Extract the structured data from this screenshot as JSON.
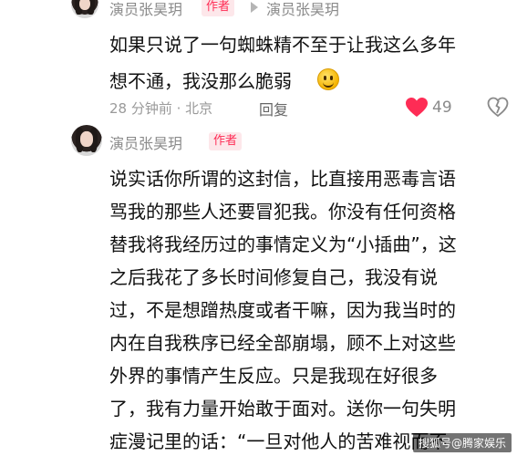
{
  "comment1": {
    "author": "演员张昊玥",
    "badge": "作者",
    "reply_to": "演员张昊玥",
    "lines": [
      "如果只说了一句蜘蛛精不至于让我这么多年",
      "想不通，我没那么脆弱"
    ],
    "emoji": "smiley-icon",
    "time": "28 分钟前 · 北京",
    "reply_label": "回复",
    "like_count": "49"
  },
  "comment2": {
    "author": "演员张昊玥",
    "badge": "作者",
    "lines": [
      "说实话你所谓的这封信，比直接用恶毒言语",
      "骂我的那些人还要冒犯我。你没有任何资格",
      "替我将我经历过的事情定义为“小插曲”，这",
      "之后我花了多长时间修复自己，我没有说",
      "过，不是想蹭热度或者干嘛，因为我当时的",
      "内在自我秩序已经全部崩塌，顾不上对这些",
      "外界的事情产生反应。只是我现在好很多",
      "了，我有力量开始敢于面对。送你一句失明",
      "症漫记里的话：“一旦对他人的苦难视而不"
    ]
  },
  "colors": {
    "accent": "#fe2c55",
    "badge_bg": "#fde7ea",
    "meta": "#9a9a9a"
  },
  "watermark": "搜狐号@腾家娱乐"
}
